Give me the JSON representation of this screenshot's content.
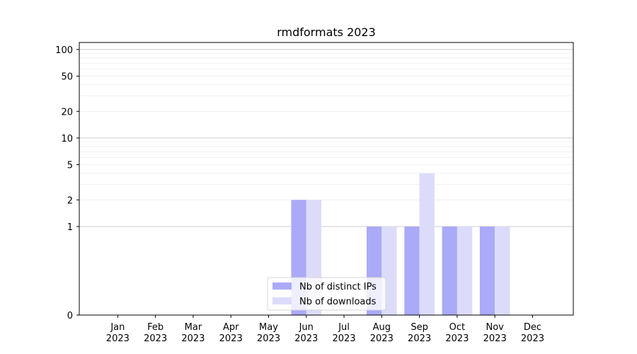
{
  "chart_data": {
    "type": "bar",
    "title": "rmdformats 2023",
    "xlabel": "",
    "ylabel": "",
    "yscale": "symlog",
    "ylim": [
      0,
      120
    ],
    "categories": [
      [
        "Jan",
        "2023"
      ],
      [
        "Feb",
        "2023"
      ],
      [
        "Mar",
        "2023"
      ],
      [
        "Apr",
        "2023"
      ],
      [
        "May",
        "2023"
      ],
      [
        "Jun",
        "2023"
      ],
      [
        "Jul",
        "2023"
      ],
      [
        "Aug",
        "2023"
      ],
      [
        "Sep",
        "2023"
      ],
      [
        "Oct",
        "2023"
      ],
      [
        "Nov",
        "2023"
      ],
      [
        "Dec",
        "2023"
      ]
    ],
    "yticks": [
      0,
      1,
      2,
      5,
      10,
      20,
      50,
      100
    ],
    "series": [
      {
        "name": "Nb of distinct IPs",
        "color": "#aaaaf8",
        "values": [
          0,
          0,
          0,
          0,
          0,
          2,
          0,
          1,
          1,
          1,
          1,
          0
        ]
      },
      {
        "name": "Nb of downloads",
        "color": "#dcdcfa",
        "values": [
          0,
          0,
          0,
          0,
          0,
          2,
          0,
          1,
          4,
          1,
          1,
          0
        ]
      }
    ],
    "grid": true,
    "legend_position": "bottom-center"
  }
}
